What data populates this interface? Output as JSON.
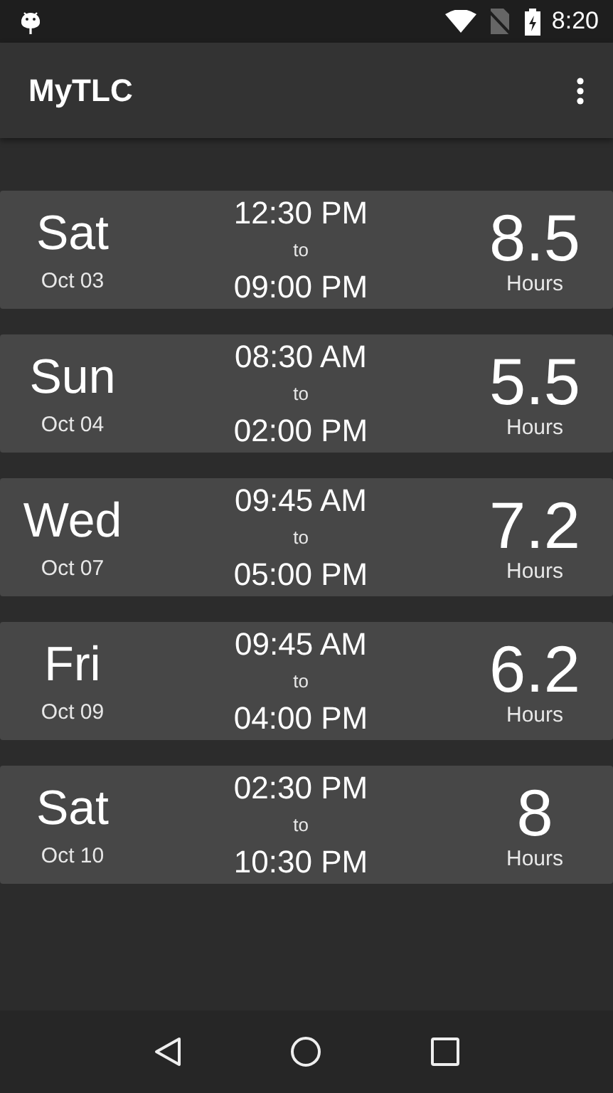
{
  "status_bar": {
    "time": "8:20"
  },
  "app_bar": {
    "title": "MyTLC"
  },
  "shifts": [
    {
      "day": "Sat",
      "date": "Oct 03",
      "start": "12:30 PM",
      "separator": "to",
      "end": "09:00 PM",
      "hours": "8.5",
      "unit": "Hours"
    },
    {
      "day": "Sun",
      "date": "Oct 04",
      "start": "08:30 AM",
      "separator": "to",
      "end": "02:00 PM",
      "hours": "5.5",
      "unit": "Hours"
    },
    {
      "day": "Wed",
      "date": "Oct 07",
      "start": "09:45 AM",
      "separator": "to",
      "end": "05:00 PM",
      "hours": "7.2",
      "unit": "Hours"
    },
    {
      "day": "Fri",
      "date": "Oct 09",
      "start": "09:45 AM",
      "separator": "to",
      "end": "04:00 PM",
      "hours": "6.2",
      "unit": "Hours"
    },
    {
      "day": "Sat",
      "date": "Oct 10",
      "start": "02:30 PM",
      "separator": "to",
      "end": "10:30 PM",
      "hours": "8",
      "unit": "Hours"
    }
  ]
}
